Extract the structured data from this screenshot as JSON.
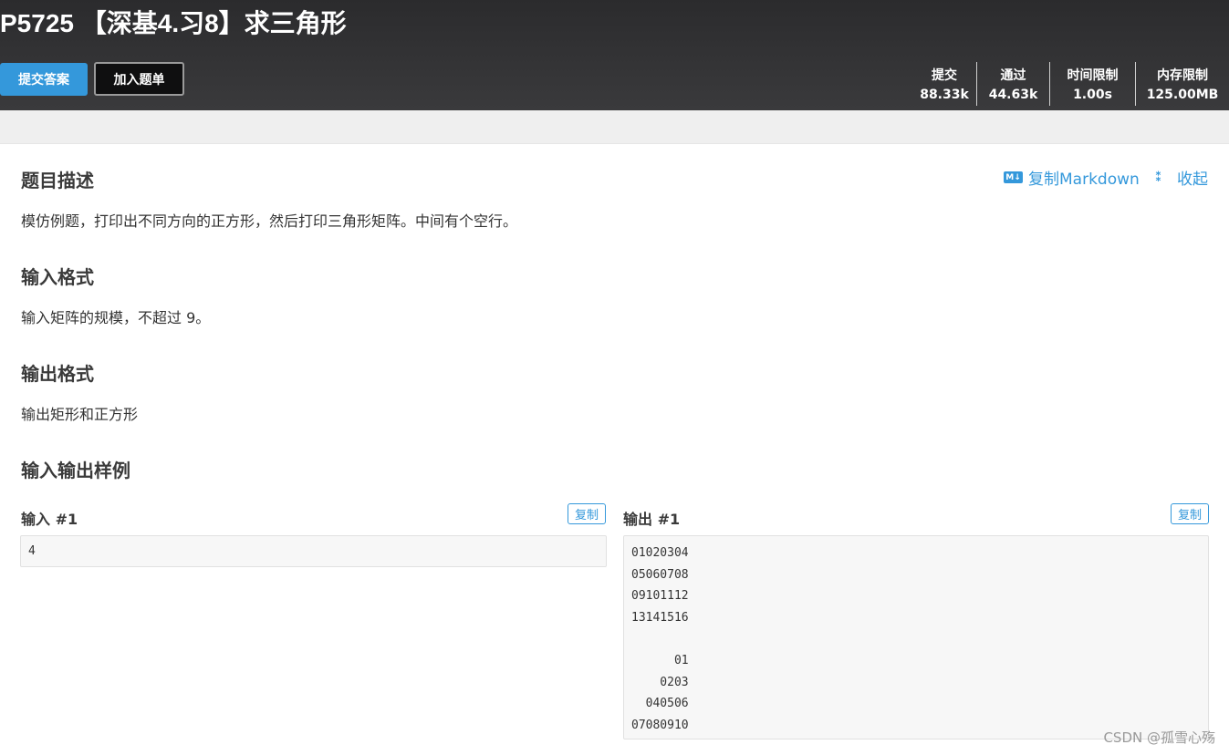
{
  "header": {
    "title": "P5725 【深基4.习8】求三角形",
    "submit_label": "提交答案",
    "add_label": "加入题单",
    "stats": [
      {
        "label": "提交",
        "value": "88.33k"
      },
      {
        "label": "通过",
        "value": "44.63k"
      },
      {
        "label": "时间限制",
        "value": "1.00s"
      },
      {
        "label": "内存限制",
        "value": "125.00MB"
      }
    ]
  },
  "toolbar": {
    "md_badge": "M↓",
    "copy_markdown": "复制Markdown",
    "collapse": "收起"
  },
  "sections": {
    "description": {
      "title": "题目描述",
      "text": "模仿例题，打印出不同方向的正方形，然后打印三角形矩阵。中间有个空行。"
    },
    "input_format": {
      "title": "输入格式",
      "text": "输入矩阵的规模，不超过 9。"
    },
    "output_format": {
      "title": "输出格式",
      "text": "输出矩形和正方形"
    },
    "samples": {
      "title": "输入输出样例"
    }
  },
  "samples": {
    "input_label": "输入 #1",
    "output_label": "输出 #1",
    "copy_label": "复制",
    "input_text": "4",
    "output_text": "01020304\n05060708\n09101112\n13141516\n\n      01\n    0203\n  040506\n07080910"
  },
  "watermark": "CSDN @孤雪心殇"
}
